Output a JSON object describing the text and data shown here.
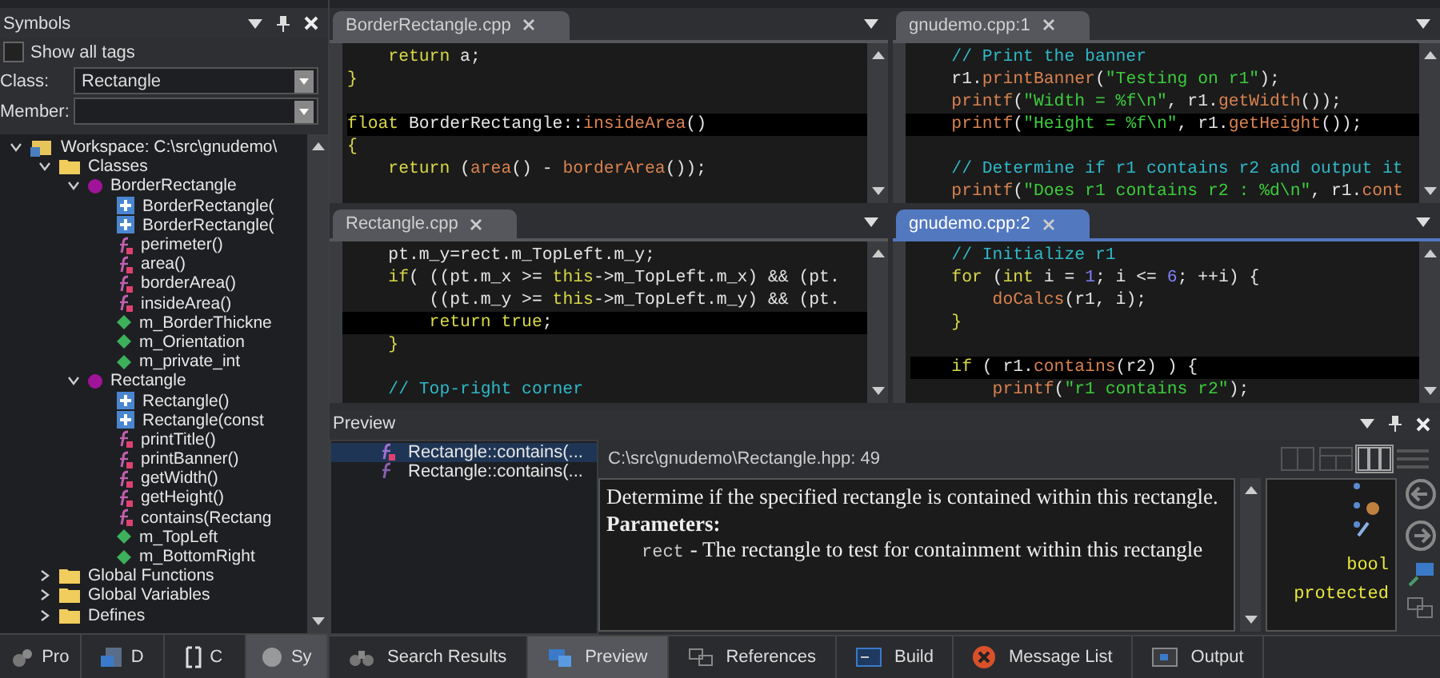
{
  "symbols": {
    "title": "Symbols",
    "show_all_tags": {
      "label": "Show all tags",
      "checked": false
    },
    "class_field": {
      "label": "Class:",
      "value": "Rectangle"
    },
    "member_field": {
      "label": "Member:"
    },
    "tree": [
      {
        "label": "Workspace: C:\\src\\gnudemo\\",
        "kind": "workspace",
        "expanded": true,
        "children": [
          {
            "label": "Classes",
            "kind": "folder",
            "expanded": true,
            "children": [
              {
                "label": "BorderRectangle",
                "kind": "class",
                "expanded": true,
                "children": [
                  {
                    "label": "BorderRectangle(",
                    "kind": "constructor"
                  },
                  {
                    "label": "BorderRectangle(",
                    "kind": "constructor"
                  },
                  {
                    "label": "perimeter()",
                    "kind": "method"
                  },
                  {
                    "label": "area()",
                    "kind": "method"
                  },
                  {
                    "label": "borderArea()",
                    "kind": "method"
                  },
                  {
                    "label": "insideArea()",
                    "kind": "method"
                  },
                  {
                    "label": "m_BorderThickne",
                    "kind": "field"
                  },
                  {
                    "label": "m_Orientation",
                    "kind": "field"
                  },
                  {
                    "label": "m_private_int",
                    "kind": "field"
                  }
                ]
              },
              {
                "label": "Rectangle",
                "kind": "class",
                "expanded": true,
                "children": [
                  {
                    "label": "Rectangle()",
                    "kind": "constructor"
                  },
                  {
                    "label": "Rectangle(const",
                    "kind": "constructor"
                  },
                  {
                    "label": "printTitle()",
                    "kind": "method"
                  },
                  {
                    "label": "printBanner()",
                    "kind": "method"
                  },
                  {
                    "label": "getWidth()",
                    "kind": "method"
                  },
                  {
                    "label": "getHeight()",
                    "kind": "method"
                  },
                  {
                    "label": "contains(Rectang",
                    "kind": "method"
                  },
                  {
                    "label": "m_TopLeft",
                    "kind": "field"
                  },
                  {
                    "label": "m_BottomRight",
                    "kind": "field"
                  }
                ]
              }
            ]
          },
          {
            "label": "Global Functions",
            "kind": "folder",
            "expanded": false
          },
          {
            "label": "Global Variables",
            "kind": "folder",
            "expanded": false
          },
          {
            "label": "Defines",
            "kind": "folder",
            "expanded": false
          }
        ]
      }
    ],
    "tabs": [
      {
        "label": "Pro",
        "kind": "project",
        "selected": false
      },
      {
        "label": "D",
        "kind": "document",
        "selected": false
      },
      {
        "label": "C",
        "kind": "code",
        "selected": false
      },
      {
        "label": "Sy",
        "kind": "symbols",
        "selected": true
      }
    ]
  },
  "editors": [
    {
      "tab": "BorderRectangle.cpp",
      "active": false,
      "lines": [
        {
          "current": false,
          "tokens": [
            {
              "kind": "keyword",
              "text": "    return"
            },
            {
              "kind": "plain",
              "text": " a;"
            }
          ]
        },
        {
          "current": false,
          "tokens": [
            {
              "kind": "keyword",
              "text": "}"
            }
          ]
        },
        {
          "current": true,
          "blank_before": true,
          "tokens": [
            {
              "kind": "keyword",
              "text": "float"
            },
            {
              "kind": "plain",
              "text": " BorderRectangle::"
            },
            {
              "kind": "function",
              "text": "insideArea"
            },
            {
              "kind": "plain",
              "text": "()"
            }
          ]
        },
        {
          "current": false,
          "tokens": [
            {
              "kind": "keyword",
              "text": "{"
            }
          ]
        },
        {
          "current": false,
          "tokens": [
            {
              "kind": "keyword",
              "text": "    return"
            },
            {
              "kind": "plain",
              "text": " ("
            },
            {
              "kind": "function",
              "text": "area"
            },
            {
              "kind": "plain",
              "text": "() - "
            },
            {
              "kind": "function",
              "text": "borderArea"
            },
            {
              "kind": "plain",
              "text": "());"
            }
          ]
        }
      ]
    },
    {
      "tab": "gnudemo.cpp:1",
      "active": false,
      "lines": [
        {
          "current": false,
          "tokens": [
            {
              "kind": "comment",
              "text": "    // Print the banner"
            }
          ]
        },
        {
          "current": false,
          "tokens": [
            {
              "kind": "plain",
              "text": "    r1."
            },
            {
              "kind": "function",
              "text": "printBanner"
            },
            {
              "kind": "plain",
              "text": "("
            },
            {
              "kind": "string",
              "text": "\"Testing on r1\""
            },
            {
              "kind": "plain",
              "text": ");"
            }
          ]
        },
        {
          "current": false,
          "tokens": [
            {
              "kind": "function",
              "text": "    printf"
            },
            {
              "kind": "plain",
              "text": "("
            },
            {
              "kind": "string",
              "text": "\"Width = %f\\n\""
            },
            {
              "kind": "plain",
              "text": ", r1."
            },
            {
              "kind": "function",
              "text": "getWidth"
            },
            {
              "kind": "plain",
              "text": "());"
            }
          ]
        },
        {
          "current": true,
          "tokens": [
            {
              "kind": "function",
              "text": "    printf"
            },
            {
              "kind": "plain",
              "text": "("
            },
            {
              "kind": "string",
              "text": "\"Height = %f\\n\""
            },
            {
              "kind": "plain",
              "text": ", r1."
            },
            {
              "kind": "function",
              "text": "getHeight"
            },
            {
              "kind": "plain",
              "text": "());"
            }
          ]
        },
        {
          "current": false,
          "blank_before": true,
          "tokens": [
            {
              "kind": "comment",
              "text": "    // Determine if r1 contains r2 and output it"
            }
          ]
        },
        {
          "current": false,
          "tokens": [
            {
              "kind": "function",
              "text": "    printf"
            },
            {
              "kind": "plain",
              "text": "("
            },
            {
              "kind": "string",
              "text": "\"Does r1 contains r2 : %d\\n\""
            },
            {
              "kind": "plain",
              "text": ", r1."
            },
            {
              "kind": "function",
              "text": "cont"
            }
          ]
        }
      ]
    },
    {
      "tab": "Rectangle.cpp",
      "active": false,
      "lines": [
        {
          "current": false,
          "tokens": [
            {
              "kind": "plain",
              "text": "    pt.m_y=rect.m_TopLeft.m_y;"
            }
          ]
        },
        {
          "current": false,
          "tokens": [
            {
              "kind": "keyword",
              "text": "    if"
            },
            {
              "kind": "plain",
              "text": "( ((pt.m_x >= "
            },
            {
              "kind": "keyword",
              "text": "this"
            },
            {
              "kind": "plain",
              "text": "->m_TopLeft.m_x) && (pt."
            }
          ]
        },
        {
          "current": false,
          "tokens": [
            {
              "kind": "plain",
              "text": "        ((pt.m_y >= "
            },
            {
              "kind": "keyword",
              "text": "this"
            },
            {
              "kind": "plain",
              "text": "->m_TopLeft.m_y) && (pt."
            }
          ]
        },
        {
          "current": true,
          "tokens": [
            {
              "kind": "keyword",
              "text": "        return true"
            },
            {
              "kind": "plain",
              "text": ";"
            }
          ]
        },
        {
          "current": false,
          "tokens": [
            {
              "kind": "keyword",
              "text": "    }"
            }
          ]
        },
        {
          "current": false,
          "blank_before": true,
          "tokens": [
            {
              "kind": "comment",
              "text": "    // Top-right corner"
            }
          ]
        }
      ]
    },
    {
      "tab": "gnudemo.cpp:2",
      "active": true,
      "lines": [
        {
          "current": false,
          "tokens": [
            {
              "kind": "comment",
              "text": "    // Initialize r1"
            }
          ]
        },
        {
          "current": false,
          "tokens": [
            {
              "kind": "keyword",
              "text": "    for"
            },
            {
              "kind": "plain",
              "text": " ("
            },
            {
              "kind": "keyword",
              "text": "int"
            },
            {
              "kind": "plain",
              "text": " i = "
            },
            {
              "kind": "number",
              "text": "1"
            },
            {
              "kind": "plain",
              "text": "; i <= "
            },
            {
              "kind": "number",
              "text": "6"
            },
            {
              "kind": "plain",
              "text": "; ++i) {"
            }
          ]
        },
        {
          "current": false,
          "tokens": [
            {
              "kind": "function",
              "text": "        doCalcs"
            },
            {
              "kind": "plain",
              "text": "(r1, i);"
            }
          ]
        },
        {
          "current": false,
          "tokens": [
            {
              "kind": "keyword",
              "text": "    }"
            }
          ]
        },
        {
          "current": true,
          "blank_before": true,
          "tokens": [
            {
              "kind": "keyword",
              "text": "    if"
            },
            {
              "kind": "plain",
              "text": " ( r1."
            },
            {
              "kind": "function",
              "text": "contains"
            },
            {
              "kind": "plain",
              "text": "(r2) ) {"
            }
          ]
        },
        {
          "current": false,
          "tokens": [
            {
              "kind": "function",
              "text": "        printf"
            },
            {
              "kind": "plain",
              "text": "("
            },
            {
              "kind": "string",
              "text": "\"r1 contains r2\""
            },
            {
              "kind": "plain",
              "text": ");"
            }
          ]
        }
      ]
    }
  ],
  "preview": {
    "title": "Preview",
    "results": [
      {
        "label": "Rectangle::contains(...",
        "kind": "method",
        "selected": true
      },
      {
        "label": "Rectangle::contains(...",
        "kind": "function",
        "selected": false
      }
    ],
    "path": "C:\\src\\gnudemo\\Rectangle.hpp: 49",
    "description": "Determime if the specified rectangle is contained within this rectangle.",
    "parameters_heading": "Parameters:",
    "parameter_name": "rect",
    "parameter_text": "- The rectangle to test for containment within this rectangle",
    "type_labels": [
      "bool",
      "protected"
    ]
  },
  "output_tabs": [
    {
      "label": "Search Results",
      "kind": "search",
      "selected": false
    },
    {
      "label": "Preview",
      "kind": "preview",
      "selected": true
    },
    {
      "label": "References",
      "kind": "references",
      "selected": false
    },
    {
      "label": "Build",
      "kind": "build",
      "selected": false
    },
    {
      "label": "Message List",
      "kind": "error",
      "selected": false
    },
    {
      "label": "Output",
      "kind": "output",
      "selected": false
    }
  ]
}
